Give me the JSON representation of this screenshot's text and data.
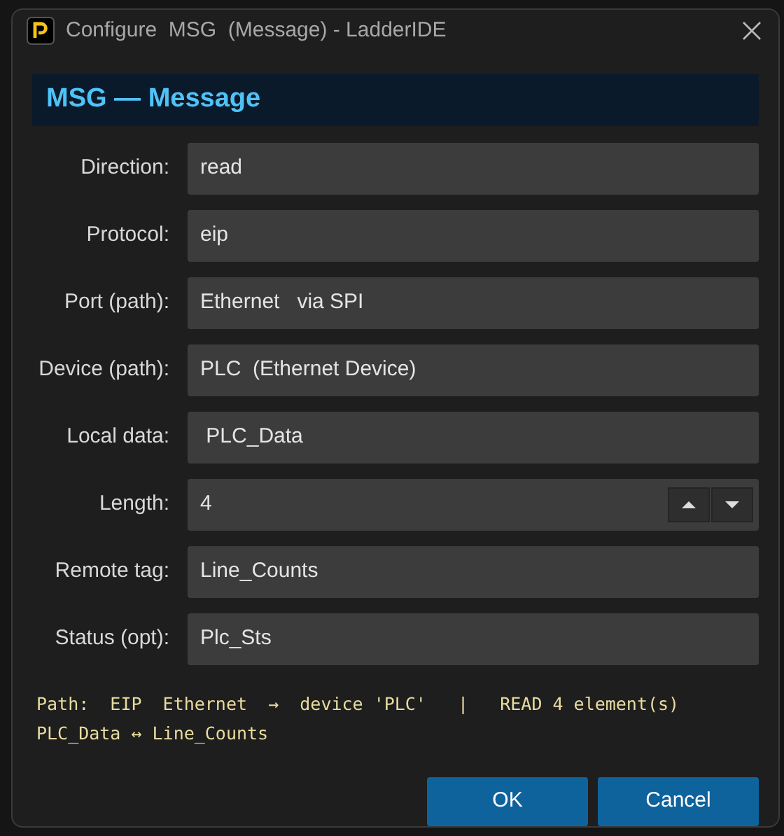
{
  "window": {
    "title": "Configure  MSG  (Message) - LadderIDE"
  },
  "header": "MSG — Message",
  "fields": [
    {
      "kind": "text",
      "label": "Direction:",
      "value": "read"
    },
    {
      "kind": "text",
      "label": "Protocol:",
      "value": "eip"
    },
    {
      "kind": "text",
      "label": "Port (path):",
      "value": "Ethernet   via SPI"
    },
    {
      "kind": "text",
      "label": "Device (path):",
      "value": "PLC  (Ethernet Device)"
    },
    {
      "kind": "text",
      "label": "Local data:",
      "value": " PLC_Data"
    },
    {
      "kind": "spin",
      "label": "Length:",
      "value": "4"
    },
    {
      "kind": "text",
      "label": "Remote tag:",
      "value": "Line_Counts"
    },
    {
      "kind": "text",
      "label": "Status (opt):",
      "value": "Plc_Sts"
    }
  ],
  "summary": [
    "Path:  EIP  Ethernet  →  device 'PLC'   |   READ 4 element(s)",
    "PLC_Data ↔ Line_Counts"
  ],
  "buttons": [
    "OK",
    "Cancel"
  ]
}
